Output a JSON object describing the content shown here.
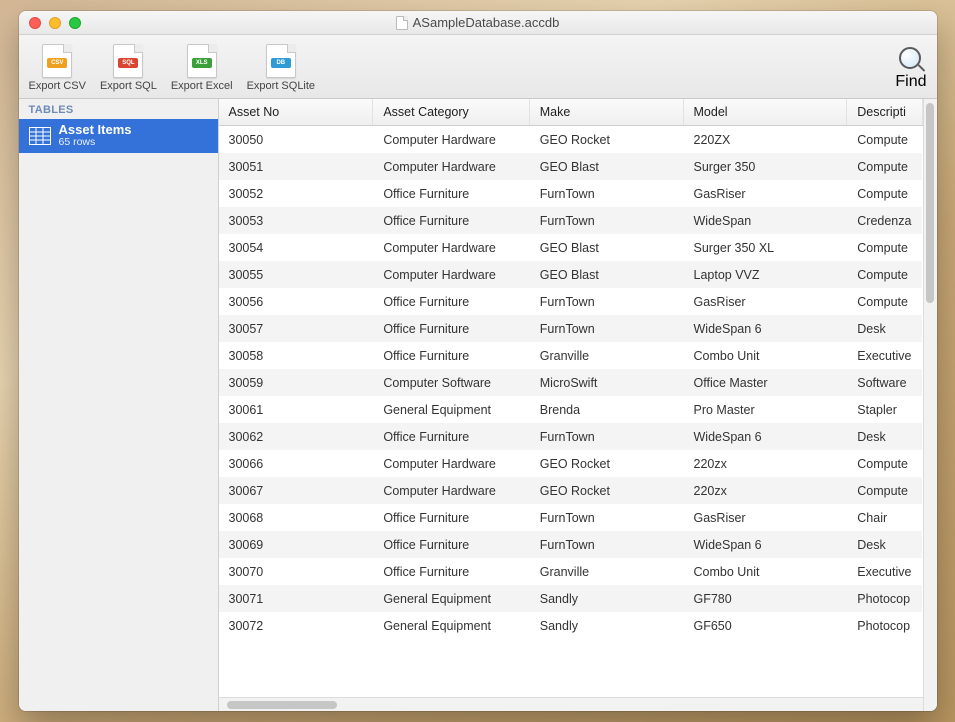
{
  "window": {
    "title": "ASampleDatabase.accdb"
  },
  "toolbar": {
    "export_csv": "Export CSV",
    "export_sql": "Export SQL",
    "export_excel": "Export Excel",
    "export_sqlite": "Export SQLite",
    "find": "Find"
  },
  "sidebar": {
    "header": "TABLES",
    "table": {
      "name": "Asset Items",
      "rows": "65 rows"
    }
  },
  "columns": [
    "Asset No",
    "Asset Category",
    "Make",
    "Model",
    "Descripti"
  ],
  "rows": [
    [
      "30050",
      "Computer Hardware",
      "GEO Rocket",
      "220ZX",
      "Compute"
    ],
    [
      "30051",
      "Computer Hardware",
      "GEO Blast",
      "Surger 350",
      "Compute"
    ],
    [
      "30052",
      "Office Furniture",
      "FurnTown",
      "GasRiser",
      "Compute"
    ],
    [
      "30053",
      "Office Furniture",
      "FurnTown",
      "WideSpan",
      "Credenza"
    ],
    [
      "30054",
      "Computer Hardware",
      "GEO Blast",
      "Surger 350 XL",
      "Compute"
    ],
    [
      "30055",
      "Computer Hardware",
      "GEO Blast",
      "Laptop VVZ",
      "Compute"
    ],
    [
      "30056",
      "Office Furniture",
      "FurnTown",
      "GasRiser",
      "Compute"
    ],
    [
      "30057",
      "Office Furniture",
      "FurnTown",
      "WideSpan 6",
      "Desk"
    ],
    [
      "30058",
      "Office Furniture",
      "Granville",
      "Combo Unit",
      "Executive"
    ],
    [
      "30059",
      "Computer Software",
      "MicroSwift",
      "Office Master",
      "Software"
    ],
    [
      "30061",
      "General Equipment",
      "Brenda",
      "Pro Master",
      "Stapler"
    ],
    [
      "30062",
      "Office Furniture",
      "FurnTown",
      "WideSpan 6",
      "Desk"
    ],
    [
      "30066",
      "Computer Hardware",
      "GEO Rocket",
      "220zx",
      "Compute"
    ],
    [
      "30067",
      "Computer Hardware",
      "GEO Rocket",
      "220zx",
      "Compute"
    ],
    [
      "30068",
      "Office Furniture",
      "FurnTown",
      "GasRiser",
      "Chair"
    ],
    [
      "30069",
      "Office Furniture",
      "FurnTown",
      "WideSpan 6",
      "Desk"
    ],
    [
      "30070",
      "Office Furniture",
      "Granville",
      "Combo Unit",
      "Executive"
    ],
    [
      "30071",
      "General Equipment",
      "Sandly",
      "GF780",
      "Photocop"
    ],
    [
      "30072",
      "General Equipment",
      "Sandly",
      "GF650",
      "Photocop"
    ]
  ]
}
